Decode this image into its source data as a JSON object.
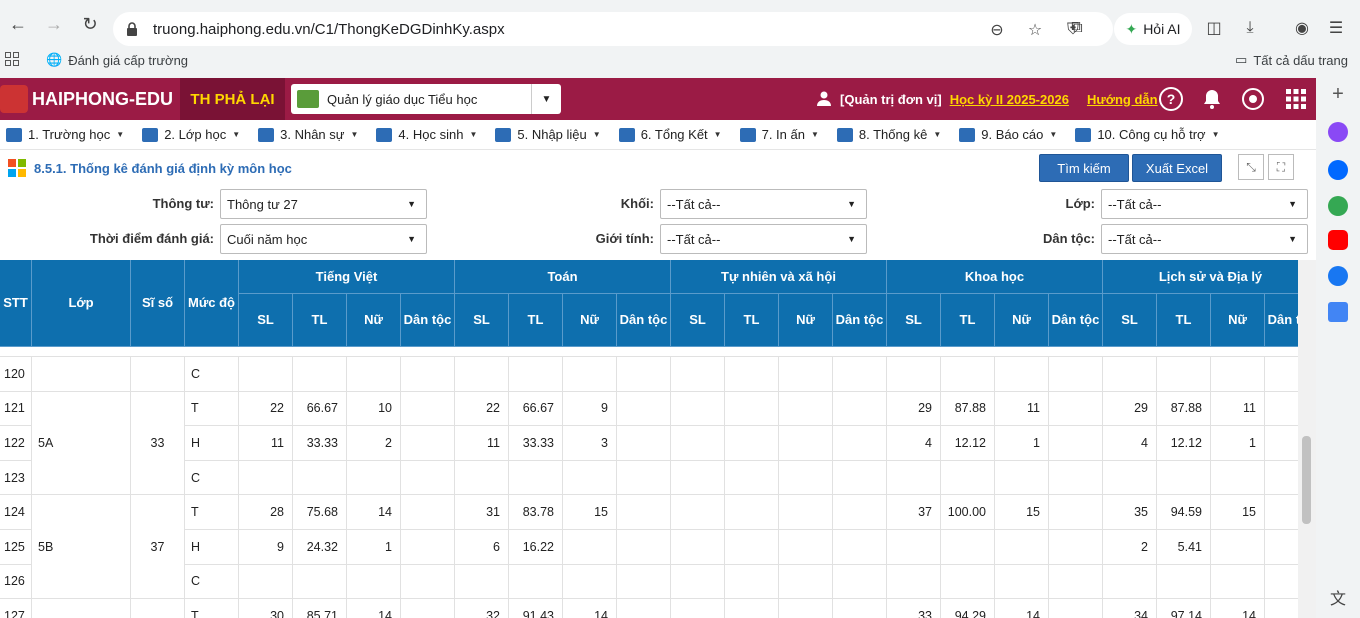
{
  "browser": {
    "url": "truong.haiphong.edu.vn/C1/ThongKeDGDinhKy.aspx",
    "ai_label": "Hỏi AI",
    "bookmark_label": "Đánh giá cấp trường",
    "all_bookmarks_label": "Tất cả dấu trang"
  },
  "app": {
    "logo_text": "HAIPHONG-EDU",
    "school": "TH PHẢ LẠI",
    "module": "Quản lý giáo dục Tiểu học",
    "user_role": "[Quản trị đơn vị]",
    "semester": "Học kỳ II 2025-2026",
    "guide": "Hướng dẫn"
  },
  "menu": [
    {
      "label": "1. Trường học"
    },
    {
      "label": "2. Lớp học"
    },
    {
      "label": "3. Nhân sự"
    },
    {
      "label": "4. Học sinh"
    },
    {
      "label": "5. Nhập liệu"
    },
    {
      "label": "6. Tổng Kết"
    },
    {
      "label": "7. In ấn"
    },
    {
      "label": "8. Thống kê"
    },
    {
      "label": "9. Báo cáo"
    },
    {
      "label": "10. Công cụ hỗ trợ"
    }
  ],
  "page": {
    "title": "8.5.1. Thống kê đánh giá định kỳ môn học",
    "search_btn": "Tìm kiếm",
    "export_btn": "Xuất Excel"
  },
  "filters": {
    "thong_tu_label": "Thông tư:",
    "thong_tu_value": "Thông tư 27",
    "khoi_label": "Khối:",
    "khoi_value": "--Tất cả--",
    "lop_label": "Lớp:",
    "lop_value": "--Tất cả--",
    "thoidiem_label": "Thời điểm đánh giá:",
    "thoidiem_value": "Cuối năm học",
    "gioitinh_label": "Giới tính:",
    "gioitinh_value": "--Tất cả--",
    "dantoc_label": "Dân tộc:",
    "dantoc_value": "--Tất cả--"
  },
  "table": {
    "headers": {
      "stt": "STT",
      "lop": "Lớp",
      "siso": "Sĩ số",
      "mucdo": "Mức độ",
      "subjects": [
        "Tiếng Việt",
        "Toán",
        "Tự nhiên và xã hội",
        "Khoa học",
        "Lịch sử và Địa lý"
      ],
      "sub": [
        "SL",
        "TL",
        "Nữ",
        "Dân tộc"
      ]
    },
    "rows": [
      {
        "stt": "120",
        "lop": "",
        "siso": "",
        "muc": "C",
        "v": [
          "",
          "",
          "",
          "",
          "",
          "",
          "",
          "",
          "",
          "",
          "",
          "",
          "",
          "",
          "",
          "",
          "",
          "",
          "",
          ""
        ]
      },
      {
        "stt": "121",
        "lop": "",
        "siso": "",
        "muc": "T",
        "v": [
          "22",
          "66.67",
          "10",
          "",
          "22",
          "66.67",
          "9",
          "",
          "",
          "",
          "",
          "",
          "29",
          "87.88",
          "11",
          "",
          "29",
          "87.88",
          "11",
          ""
        ]
      },
      {
        "stt": "122",
        "lop": "5A",
        "siso": "33",
        "muc": "H",
        "v": [
          "11",
          "33.33",
          "2",
          "",
          "11",
          "33.33",
          "3",
          "",
          "",
          "",
          "",
          "",
          "4",
          "12.12",
          "1",
          "",
          "4",
          "12.12",
          "1",
          ""
        ]
      },
      {
        "stt": "123",
        "lop": "",
        "siso": "",
        "muc": "C",
        "v": [
          "",
          "",
          "",
          "",
          "",
          "",
          "",
          "",
          "",
          "",
          "",
          "",
          "",
          "",
          "",
          "",
          "",
          "",
          "",
          ""
        ]
      },
      {
        "stt": "124",
        "lop": "",
        "siso": "",
        "muc": "T",
        "v": [
          "28",
          "75.68",
          "14",
          "",
          "31",
          "83.78",
          "15",
          "",
          "",
          "",
          "",
          "",
          "37",
          "100.00",
          "15",
          "",
          "35",
          "94.59",
          "15",
          ""
        ]
      },
      {
        "stt": "125",
        "lop": "5B",
        "siso": "37",
        "muc": "H",
        "v": [
          "9",
          "24.32",
          "1",
          "",
          "6",
          "16.22",
          "",
          "",
          "",
          "",
          "",
          "",
          "",
          "",
          "",
          "",
          "2",
          "5.41",
          "",
          ""
        ]
      },
      {
        "stt": "126",
        "lop": "",
        "siso": "",
        "muc": "C",
        "v": [
          "",
          "",
          "",
          "",
          "",
          "",
          "",
          "",
          "",
          "",
          "",
          "",
          "",
          "",
          "",
          "",
          "",
          "",
          "",
          ""
        ]
      },
      {
        "stt": "127",
        "lop": "",
        "siso": "",
        "muc": "T",
        "v": [
          "30",
          "85.71",
          "14",
          "",
          "32",
          "91.43",
          "14",
          "",
          "",
          "",
          "",
          "",
          "33",
          "94.29",
          "14",
          "",
          "34",
          "97.14",
          "14",
          ""
        ]
      }
    ]
  },
  "colors": {
    "header_bg": "#9b1b45",
    "table_header_bg": "#0e6fae",
    "accent": "#2d6cb5",
    "school_text": "#ffd700"
  }
}
